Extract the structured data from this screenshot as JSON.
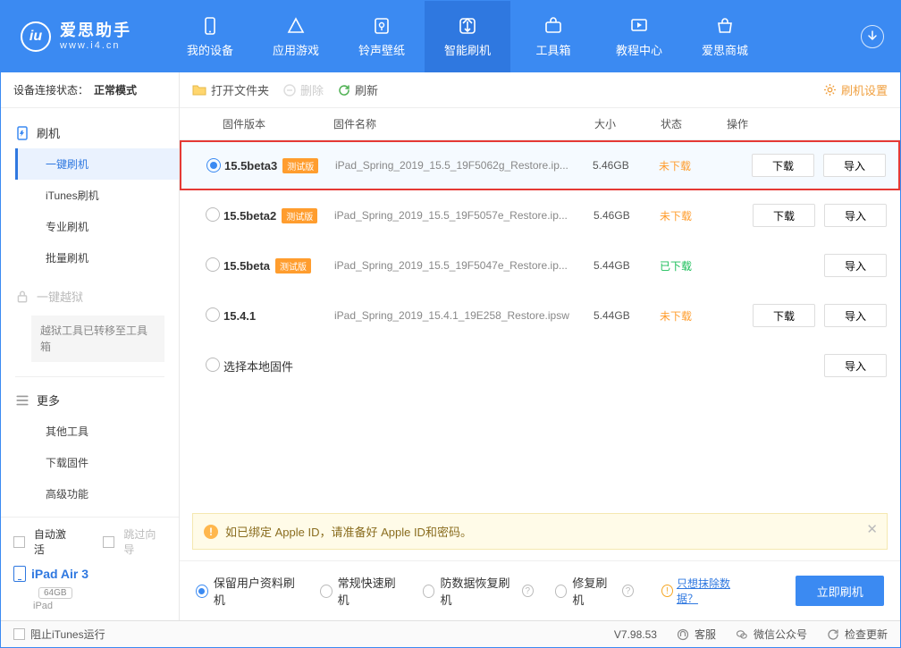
{
  "window": {
    "controls": [
      "⚙",
      "▤",
      "—",
      "◻",
      "✕"
    ]
  },
  "header": {
    "app_title": "爱思助手",
    "app_sub": "www.i4.cn",
    "nav": [
      {
        "id": "device",
        "label": "我的设备"
      },
      {
        "id": "apps",
        "label": "应用游戏"
      },
      {
        "id": "wall",
        "label": "铃声壁纸"
      },
      {
        "id": "flash",
        "label": "智能刷机",
        "active": true
      },
      {
        "id": "tools",
        "label": "工具箱"
      },
      {
        "id": "tutorial",
        "label": "教程中心"
      },
      {
        "id": "store",
        "label": "爱思商城"
      }
    ]
  },
  "sidebar": {
    "conn_label": "设备连接状态：",
    "conn_value": "正常模式",
    "groups": {
      "flash": {
        "title": "刷机",
        "items": [
          "一键刷机",
          "iTunes刷机",
          "专业刷机",
          "批量刷机"
        ],
        "active_index": 0
      },
      "jailbreak": {
        "title": "一键越狱",
        "note": "越狱工具已转移至工具箱",
        "locked": true
      },
      "more": {
        "title": "更多",
        "items": [
          "其他工具",
          "下载固件",
          "高级功能"
        ]
      }
    },
    "bottom": {
      "auto_activate": "自动激活",
      "skip_guide": "跳过向导",
      "device_name": "iPad Air 3",
      "capacity": "64GB",
      "device_sub": "iPad"
    }
  },
  "toolbar": {
    "open_folder": "打开文件夹",
    "delete": "删除",
    "refresh": "刷新",
    "settings": "刷机设置"
  },
  "columns": {
    "version": "固件版本",
    "name": "固件名称",
    "size": "大小",
    "status": "状态",
    "action": "操作"
  },
  "actions": {
    "download": "下载",
    "import": "导入"
  },
  "firmware": [
    {
      "selected": true,
      "highlight": true,
      "version": "15.5beta3",
      "beta": true,
      "name": "iPad_Spring_2019_15.5_19F5062g_Restore.ip...",
      "size": "5.46GB",
      "status": "未下载",
      "status_color": "orange",
      "can_download": true
    },
    {
      "selected": false,
      "highlight": false,
      "version": "15.5beta2",
      "beta": true,
      "name": "iPad_Spring_2019_15.5_19F5057e_Restore.ip...",
      "size": "5.46GB",
      "status": "未下载",
      "status_color": "orange",
      "can_download": true
    },
    {
      "selected": false,
      "highlight": false,
      "version": "15.5beta",
      "beta": true,
      "name": "iPad_Spring_2019_15.5_19F5047e_Restore.ip...",
      "size": "5.44GB",
      "status": "已下载",
      "status_color": "green",
      "can_download": false
    },
    {
      "selected": false,
      "highlight": false,
      "version": "15.4.1",
      "beta": false,
      "name": "iPad_Spring_2019_15.4.1_19E258_Restore.ipsw",
      "size": "5.44GB",
      "status": "未下载",
      "status_color": "orange",
      "can_download": true
    }
  ],
  "local_row": {
    "label": "选择本地固件"
  },
  "beta_tag": "测试版",
  "warning": {
    "text": "如已绑定 Apple ID，请准备好 Apple ID和密码。"
  },
  "flash_options": {
    "opts": [
      {
        "label": "保留用户资料刷机",
        "on": true
      },
      {
        "label": "常规快速刷机"
      },
      {
        "label": "防数据恢复刷机",
        "help": true
      },
      {
        "label": "修复刷机",
        "help": true
      }
    ],
    "erase_hint_icon": "!",
    "erase_link": "只想抹除数据？",
    "go": "立即刷机"
  },
  "statusbar": {
    "block_itunes": "阻止iTunes运行",
    "version": "V7.98.53",
    "support": "客服",
    "wechat": "微信公众号",
    "update": "检查更新"
  }
}
